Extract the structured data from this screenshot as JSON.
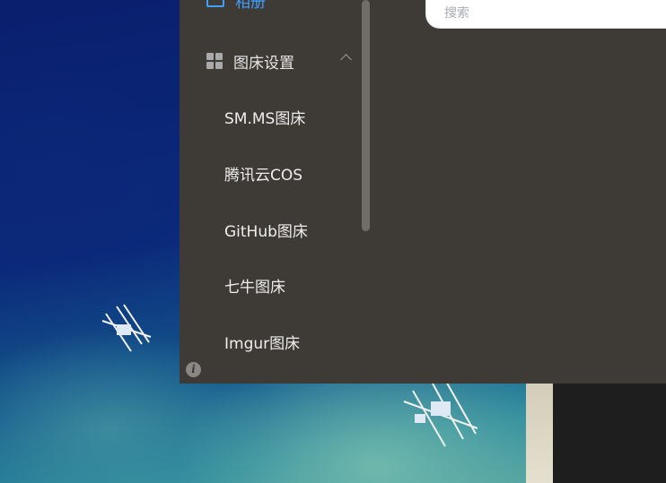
{
  "sidebar": {
    "top_item": {
      "label": "相册",
      "icon": "album-icon"
    },
    "group": {
      "label": "图床设置",
      "icon": "grid-icon",
      "expanded": true
    },
    "sub_items": [
      {
        "label": "SM.MS图床"
      },
      {
        "label": "腾讯云COS"
      },
      {
        "label": "GitHub图床"
      },
      {
        "label": "七牛图床"
      },
      {
        "label": "Imgur图床"
      }
    ]
  },
  "search": {
    "placeholder": "搜索"
  },
  "colors": {
    "accent": "#409eff",
    "panel": "#3e3a36"
  }
}
